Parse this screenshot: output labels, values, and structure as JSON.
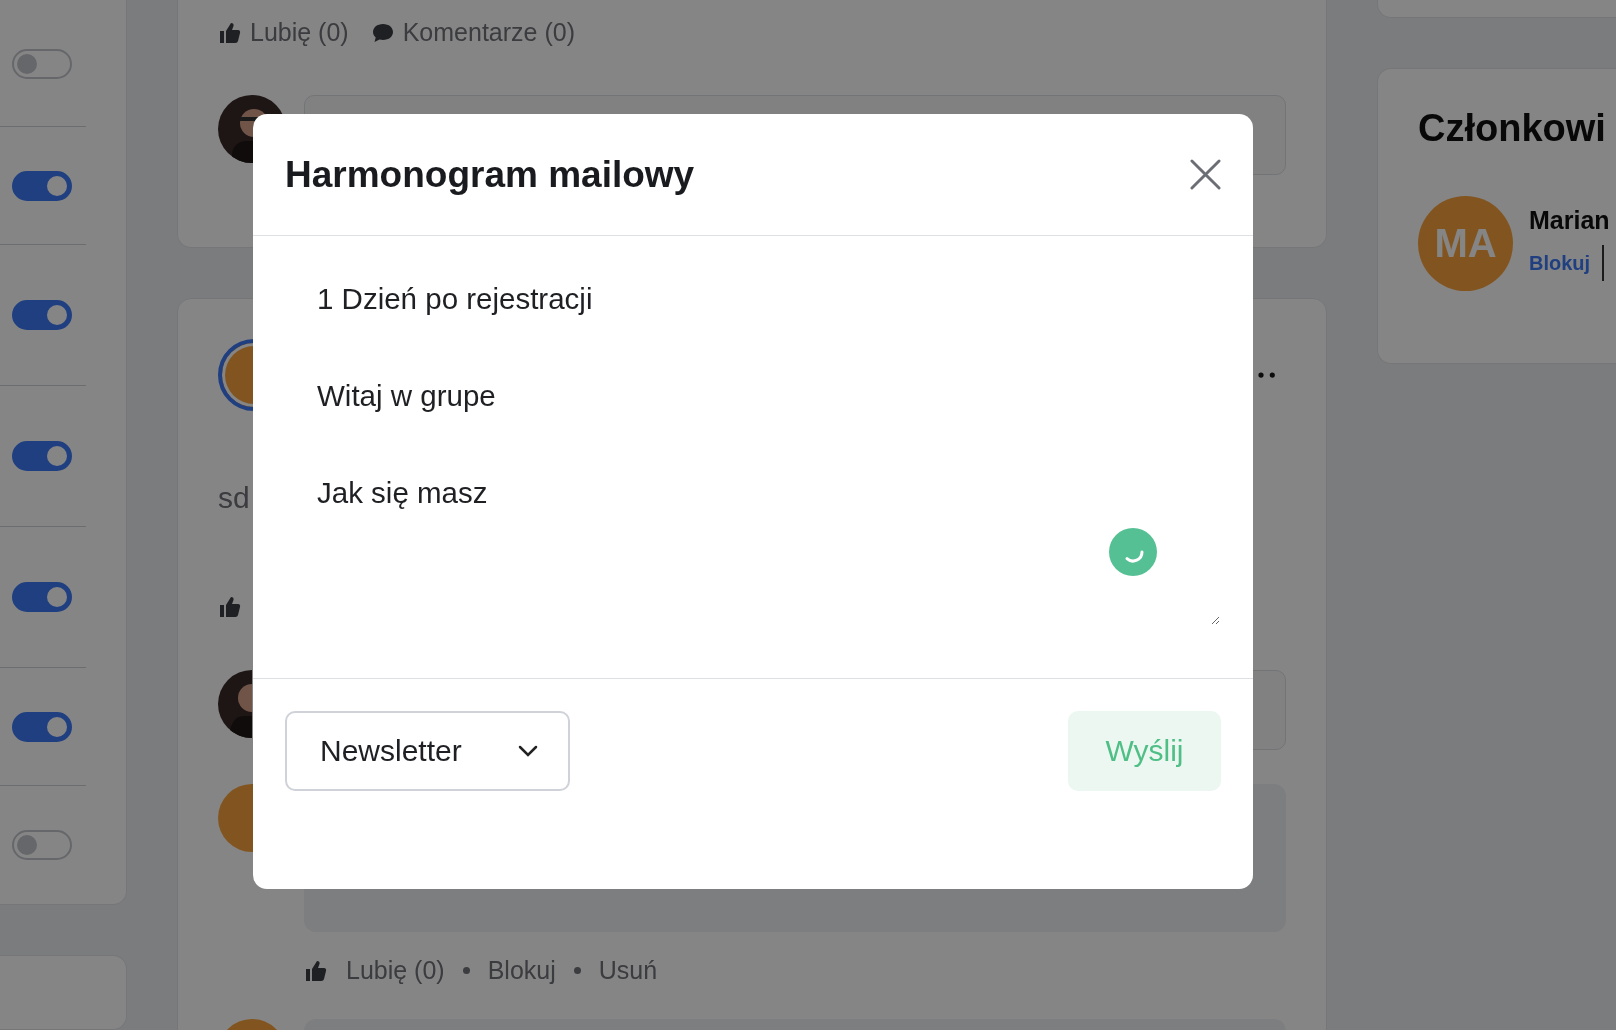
{
  "sidebar": {
    "toggles": [
      {
        "on": false
      },
      {
        "on": true
      },
      {
        "on": true
      },
      {
        "on": true
      },
      {
        "on": true
      },
      {
        "on": true
      },
      {
        "on": false
      }
    ]
  },
  "feed": {
    "post_1": {
      "actions": [
        {
          "kind": "like",
          "label": "Lubię (0)"
        },
        {
          "kind": "comments",
          "label": "Komentarze (0)"
        }
      ]
    },
    "post_2": {
      "text": "sd",
      "comment": {
        "actions": [
          "Lubię (0)",
          "Blokuj",
          "Usuń"
        ]
      }
    }
  },
  "members": {
    "title": "Członkowi",
    "items": [
      {
        "initials": "MA",
        "name": "Marian",
        "action": "Blokuj"
      }
    ]
  },
  "modal": {
    "title": "Harmonogram mailowy",
    "message": {
      "lines": [
        "1 Dzień po rejestracji",
        "Witaj w grupe",
        "Jak się masz"
      ]
    },
    "select": {
      "value": "Newsletter"
    },
    "send_button": "Wyślij"
  }
}
